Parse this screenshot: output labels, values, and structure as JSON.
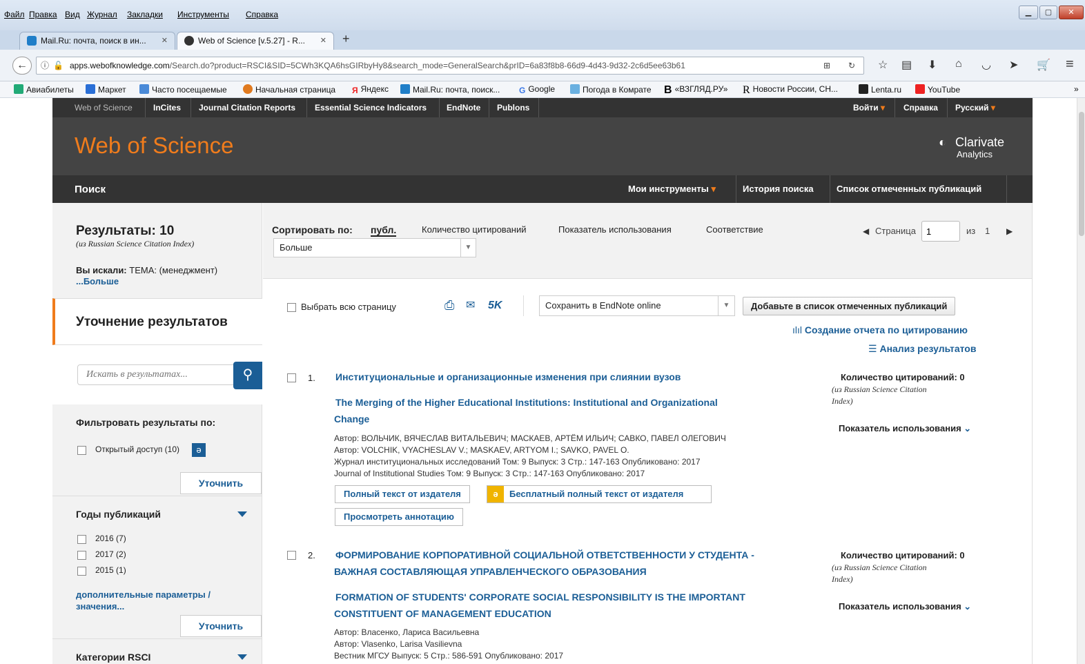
{
  "browser": {
    "menu": [
      "Файл",
      "Правка",
      "Вид",
      "Журнал",
      "Закладки",
      "Инструменты",
      "Справка"
    ],
    "tabs": [
      {
        "label": "Mail.Ru: почта, поиск в ин...",
        "active": false
      },
      {
        "label": "Web of Science [v.5.27] - R...",
        "active": true
      }
    ],
    "new_tab": "+",
    "url_host": "apps.webofknowledge.com",
    "url_rest": "/Search.do?product=RSCI&SID=5CWh3KQA6hsGIRbyHy8&search_mode=GeneralSearch&prID=6a83f8b8-66d9-4d43-9d32-2c6d5ee63b61",
    "bookmarks": [
      "Авиабилеты",
      "Маркет",
      "Часто посещаемые",
      "Начальная страница",
      "Яндекс",
      "Mail.Ru: почта, поиск...",
      "Google",
      "Погода в Комрате",
      "«ВЗГЛЯД.РУ»",
      "Новости России, СН...",
      "Lenta.ru",
      "YouTube"
    ],
    "bookmarks_more": "»"
  },
  "topnav": {
    "items": [
      "Web of Science",
      "InCites",
      "Journal Citation Reports",
      "Essential Science Indicators",
      "EndNote",
      "Publons"
    ],
    "login": "Войти",
    "help": "Справка",
    "lang": "Русский"
  },
  "header": {
    "title": "Web of Science",
    "brand": "Clarivate",
    "brand_sub": "Analytics"
  },
  "subnav": {
    "search": "Поиск",
    "tools": "Мои инструменты",
    "history": "История поиска",
    "marked": "Список отмеченных публикаций"
  },
  "left": {
    "results_label": "Результаты: 10",
    "results_source": "(из Russian Science Citation Index)",
    "searched_label": "Вы искали:",
    "searched_value": "ТЕМА: (менеджмент)",
    "more": "...Больше",
    "refine_title": "Уточнение результатов",
    "search_placeholder": "Искать в результатах...",
    "filter_title": "Фильтровать результаты по:",
    "open_access": "Открытый доступ (10)",
    "refine_btn": "Уточнить",
    "years_title": "Годы публикаций",
    "years": [
      "2016 (7)",
      "2017 (2)",
      "2015 (1)"
    ],
    "more_params": "дополнительные параметры / значения...",
    "categories_title": "Категории RSCI"
  },
  "sort": {
    "label": "Сортировать по:",
    "options": [
      "публ.",
      "Количество цитирований",
      "Показатель использования",
      "Соответствие"
    ],
    "more_select": "Больше",
    "page_label": "Страница",
    "page_value": "1",
    "of_label": "из",
    "total_pages": "1"
  },
  "toolbar": {
    "select_all": "Выбрать всю страницу",
    "five_k": "5K",
    "save_select": "Сохранить в EndNote online",
    "add_marked": "Добавьте в список отмеченных публикаций",
    "citation_report": "Создание отчета по цитированию",
    "analyze": "Анализ результатов"
  },
  "results": [
    {
      "num": "1.",
      "title_ru": "Институциональные и организационные изменения при слиянии вузов",
      "title_en_1": "The Merging of the Higher Educational Institutions: Institutional and Organizational",
      "title_en_2": "Change",
      "lines": [
        "Автор: ВОЛЬЧИК, ВЯЧЕСЛАВ ВИТАЛЬЕВИЧ; МАСКАЕВ, АРТЁМ ИЛЬИЧ; САВКО, ПАВЕЛ ОЛЕГОВИЧ",
        "Автор: VOLCHIK, VYACHESLAV V.; MASKAEV, ARTYOM I.; SAVKO, PAVEL O.",
        "Журнал институциональных исследований  Том: 9   Выпуск: 3   Стр.: 147-163   Опубликовано: 2017",
        "Journal of Institutional Studies  Том: 9   Выпуск: 3   Стр.: 147-163   Опубликовано: 2017"
      ],
      "btn_full": "Полный текст от издателя",
      "btn_free": "Бесплатный полный текст от издателя",
      "btn_abstract": "Просмотреть аннотацию",
      "cites": "Количество цитирований: 0",
      "cites_src_1": "(из Russian Science Citation",
      "cites_src_2": "Index)",
      "usage": "Показатель использования"
    },
    {
      "num": "2.",
      "title_ru_1": "ФОРМИРОВАНИЕ КОРПОРАТИВНОЙ СОЦИАЛЬНОЙ ОТВЕТСТВЕННОСТИ У СТУДЕНТА -",
      "title_ru_2": "ВАЖНАЯ СОСТАВЛЯЮЩАЯ УПРАВЛЕНЧЕСКОГО ОБРАЗОВАНИЯ",
      "title_en_1": "FORMATION OF STUDENTS' CORPORATE SOCIAL RESPONSIBILITY IS THE IMPORTANT",
      "title_en_2": "CONSTITUENT OF MANAGEMENT EDUCATION",
      "lines": [
        "Автор: Власенко, Лариса Васильевна",
        "Автор: Vlasenko, Larisa Vasilievna",
        "Вестник МГСУ  Выпуск: 5   Стр.: 586-591   Опубликовано: 2017"
      ],
      "cites": "Количество цитирований: 0",
      "cites_src_1": "(из Russian Science Citation",
      "cites_src_2": "Index)",
      "usage": "Показатель использования"
    }
  ],
  "colors": {
    "accent_orange": "#f07c1c",
    "link_blue": "#1b5e96",
    "dark_bar": "#333333",
    "header_gray": "#444444"
  }
}
